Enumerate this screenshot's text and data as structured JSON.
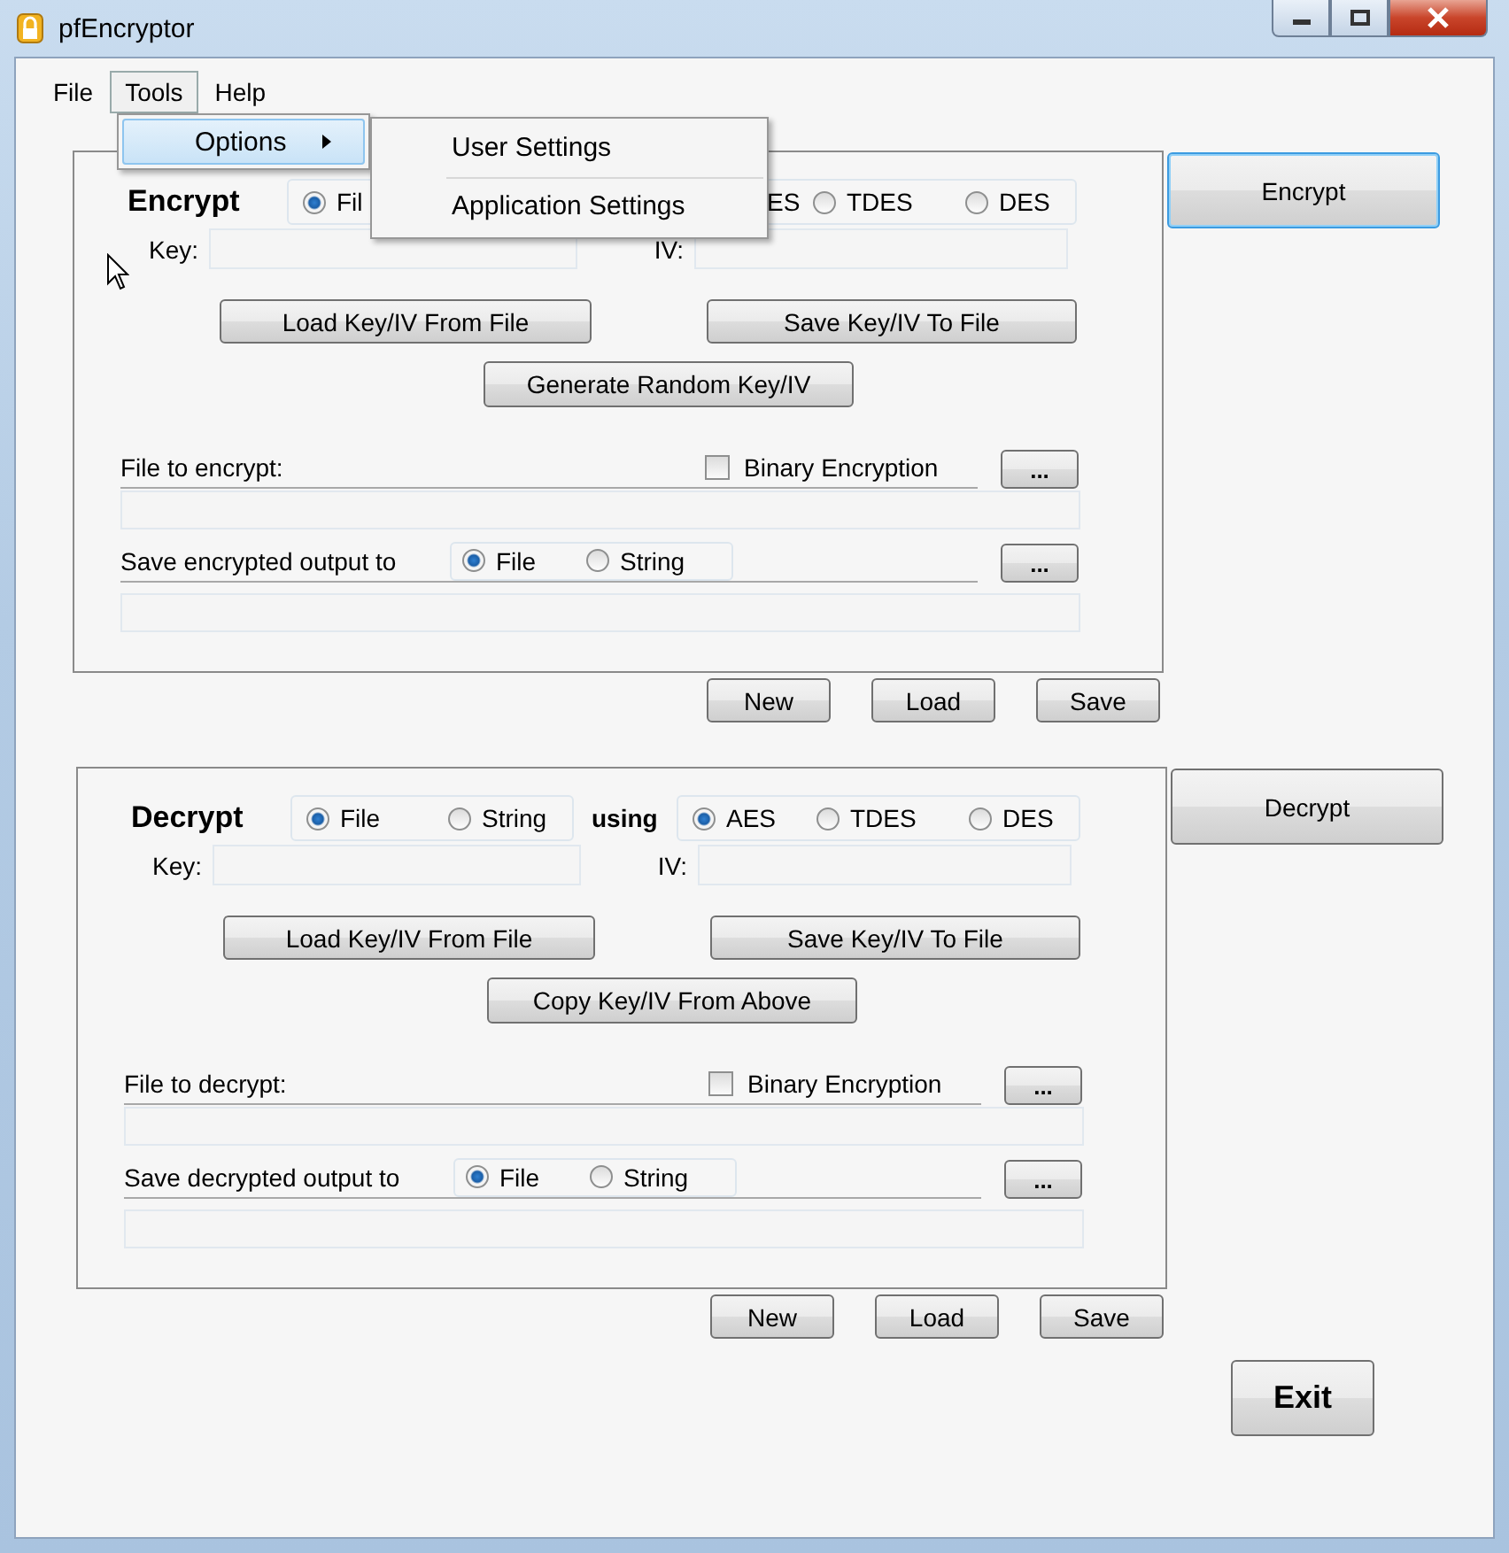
{
  "window": {
    "title": "pfEncryptor"
  },
  "menu_bar": [
    {
      "label": "File",
      "selected": false
    },
    {
      "label": "Tools",
      "selected": true
    },
    {
      "label": "Help",
      "selected": false
    }
  ],
  "menu": {
    "items": [
      {
        "label": "Options",
        "selected": true
      }
    ],
    "submenu": [
      {
        "label": "User Settings"
      },
      {
        "label": "Application Settings"
      }
    ]
  },
  "sections": [
    {
      "title": "Encrypt",
      "mode_options": [
        {
          "label": "Fil",
          "selected": true
        }
      ],
      "algorithm_options": [
        {
          "kind": "cut",
          "label": "ES"
        },
        {
          "kind": "radio",
          "label": "TDES",
          "selected": false
        },
        {
          "kind": "radio",
          "label": "DES",
          "selected": false
        }
      ],
      "key_label": "Key:",
      "iv_label": "IV:",
      "load_button": "Load Key/IV From File",
      "save_button": "Save Key/IV To File",
      "extra_button": "Generate Random Key/IV",
      "file_label": "File to encrypt:",
      "binary": {
        "label": "Binary Encryption",
        "checked": false
      },
      "browse_button": "...",
      "output_label": "Save encrypted output to",
      "output_options": [
        {
          "label": "File",
          "selected": true
        },
        {
          "label": "String",
          "selected": false
        }
      ],
      "output_browse_button": "...",
      "action_button": {
        "label": "Encrypt",
        "focused": true
      },
      "footer_buttons": [
        "New",
        "Load",
        "Save"
      ]
    },
    {
      "title": "Decrypt",
      "mode_options": [
        {
          "label": "File",
          "selected": true
        },
        {
          "label": "String",
          "selected": false
        }
      ],
      "using": "using",
      "algorithm_options": [
        {
          "kind": "radio",
          "label": "AES",
          "selected": true
        },
        {
          "kind": "radio",
          "label": "TDES",
          "selected": false
        },
        {
          "kind": "radio",
          "label": "DES",
          "selected": false
        }
      ],
      "key_label": "Key:",
      "iv_label": "IV:",
      "load_button": "Load Key/IV From File",
      "save_button": "Save Key/IV To File",
      "extra_button": "Copy Key/IV From Above",
      "file_label": "File to decrypt:",
      "binary": {
        "label": "Binary Encryption",
        "checked": false
      },
      "browse_button": "...",
      "output_label": "Save decrypted output to",
      "output_options": [
        {
          "label": "File",
          "selected": true
        },
        {
          "label": "String",
          "selected": false
        }
      ],
      "output_browse_button": "...",
      "action_button": {
        "label": "Decrypt",
        "focused": false
      },
      "footer_buttons": [
        "New",
        "Load",
        "Save"
      ]
    }
  ],
  "exit_button": "Exit"
}
